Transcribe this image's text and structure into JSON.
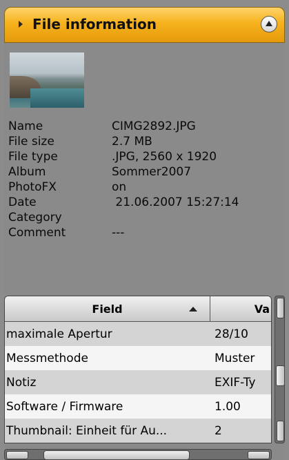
{
  "header": {
    "title": "File information"
  },
  "file_info": {
    "rows": [
      {
        "label": "Name",
        "value": "CIMG2892.JPG"
      },
      {
        "label": "File size",
        "value": "2.7 MB"
      },
      {
        "label": "File type",
        "value": ".JPG, 2560 x 1920"
      },
      {
        "label": "Album",
        "value": "Sommer2007"
      },
      {
        "label": "PhotoFX",
        "value": "on"
      },
      {
        "label": "Date",
        "value": " 21.06.2007 15:27:14"
      },
      {
        "label": "Category",
        "value": ""
      },
      {
        "label": "Comment",
        "value": "---"
      }
    ]
  },
  "exif_table": {
    "columns": [
      "Field",
      "Va"
    ],
    "rows": [
      {
        "field": "maximale Apertur",
        "value": "28/10"
      },
      {
        "field": "Messmethode",
        "value": "Muster"
      },
      {
        "field": "Notiz",
        "value": "EXIF-Ty"
      },
      {
        "field": "Software / Firmware",
        "value": "1.00"
      },
      {
        "field": "Thumbnail: Einheit für Au...",
        "value": "2"
      }
    ]
  },
  "colors": {
    "header_accent": "#f6b21c",
    "panel_bg": "#8a8a8a"
  },
  "icons": {
    "expand": "triangle-right-icon",
    "collapse": "circle-up-icon",
    "sort": "sort-ascending-icon"
  }
}
